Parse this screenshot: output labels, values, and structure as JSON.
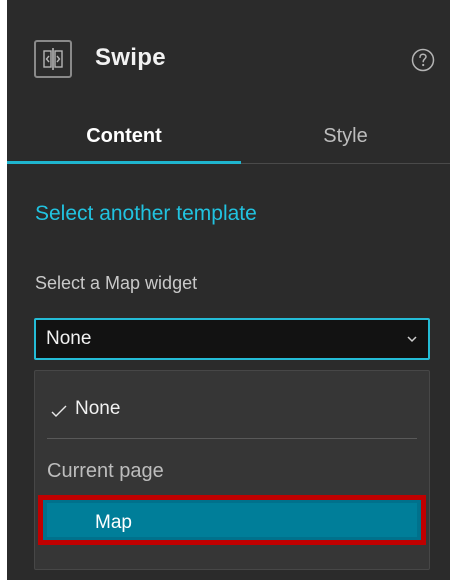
{
  "header": {
    "title": "Swipe",
    "icon": "swipe-widget-icon",
    "help_icon": "help-icon"
  },
  "tabs": [
    {
      "label": "Content",
      "active": true
    },
    {
      "label": "Style",
      "active": false
    }
  ],
  "content": {
    "template_link": "Select another template",
    "map_widget_label": "Select a Map widget",
    "select_value": "None"
  },
  "dropdown": {
    "selected_option": "None",
    "group_label": "Current page",
    "group_options": [
      "Map"
    ],
    "highlighted_option": "Map"
  },
  "colors": {
    "panel_bg": "#2b2b2b",
    "accent": "#1fb5cf",
    "highlight_bg": "#007e99",
    "annotation_border": "#c00000"
  }
}
